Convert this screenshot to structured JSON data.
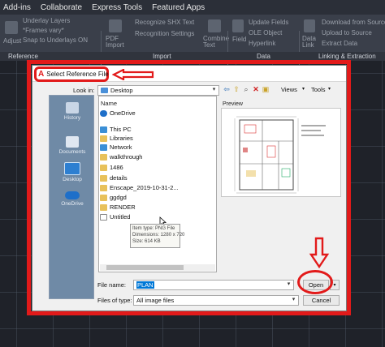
{
  "menubar": {
    "items": [
      "Add-ins",
      "Collaborate",
      "Express Tools",
      "Featured Apps"
    ]
  },
  "ribbon": {
    "groups": {
      "reference": "Reference",
      "import": "Import",
      "data": "Data",
      "linking": "Linking & Extraction"
    },
    "items": {
      "adjust": "Adjust",
      "underlay_layers": "Underlay Layers",
      "frames_vary": "*Frames vary*",
      "snap_to_underlays": "Snap to Underlays ON",
      "pdf_import": "PDF Import",
      "recognize_shx": "Recognize SHX Text",
      "recognition_settings": "Recognition Settings",
      "combine_text": "Combine Text",
      "field": "Field",
      "update_fields": "Update Fields",
      "ole_object": "OLE Object",
      "hyperlink": "Hyperlink",
      "data_link": "Data Link",
      "download_from_source": "Download from Source",
      "upload_to_source": "Upload to Source",
      "extract_data": "Extract Data"
    }
  },
  "dialog": {
    "title": "Select Reference File",
    "look_in_label": "Look in:",
    "look_in_value": "Desktop",
    "views_label": "Views",
    "tools_label": "Tools",
    "places": [
      "History",
      "Documents",
      "Desktop",
      "OneDrive"
    ],
    "file_list": {
      "column_header": "Name",
      "items": [
        {
          "name": "OneDrive",
          "icon": "cloud-icon"
        },
        {
          "name": "This PC",
          "icon": "computer-icon"
        },
        {
          "name": "Libraries",
          "icon": "folder-icon"
        },
        {
          "name": "Network",
          "icon": "network-icon"
        },
        {
          "name": "walkthrough",
          "icon": "folder-icon"
        },
        {
          "name": "1486",
          "icon": "folder-icon"
        },
        {
          "name": "details",
          "icon": "folder-icon"
        },
        {
          "name": "Enscape_2019-10-31-2...",
          "icon": "folder-icon"
        },
        {
          "name": "ggdgd",
          "icon": "folder-icon"
        },
        {
          "name": "RENDER",
          "icon": "folder-icon"
        },
        {
          "name": "Untitled",
          "icon": "image-file-icon"
        }
      ]
    },
    "tooltip": {
      "line1": "Item type: PNG File",
      "line2": "Dimensions: 1280 x 720",
      "line3": "Size: 614 KB"
    },
    "preview_label": "Preview",
    "file_name_label": "File name:",
    "file_name_value": "PLAN",
    "files_of_type_label": "Files of type:",
    "files_of_type_value": "All image files",
    "open_label": "Open",
    "cancel_label": "Cancel"
  },
  "colors": {
    "highlight_red": "#e21a1a",
    "folder_yellow": "#e8c15a",
    "selection_blue": "#0078d7"
  }
}
